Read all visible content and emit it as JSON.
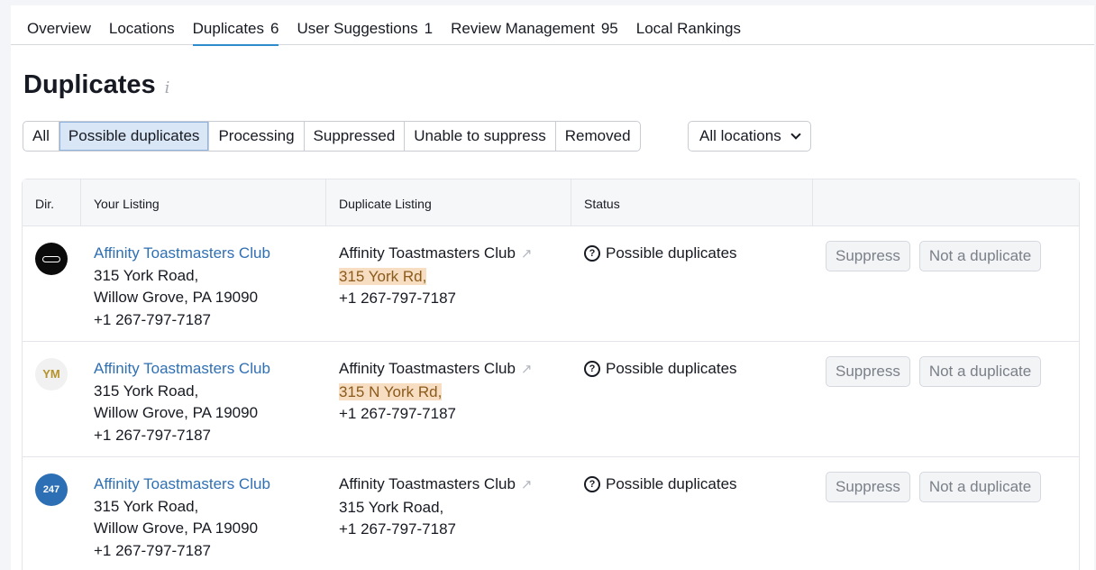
{
  "tabs": [
    {
      "label": "Overview",
      "count": ""
    },
    {
      "label": "Locations",
      "count": ""
    },
    {
      "label": "Duplicates",
      "count": "6"
    },
    {
      "label": "User Suggestions",
      "count": "1"
    },
    {
      "label": "Review Management",
      "count": "95"
    },
    {
      "label": "Local Rankings",
      "count": ""
    }
  ],
  "page": {
    "title": "Duplicates",
    "info_icon": "i"
  },
  "filters": {
    "items": [
      "All",
      "Possible duplicates",
      "Processing",
      "Suppressed",
      "Unable to suppress",
      "Removed"
    ],
    "active": "Possible duplicates",
    "location_select": "All locations"
  },
  "table": {
    "headers": {
      "dir": "Dir.",
      "your_listing": "Your Listing",
      "duplicate_listing": "Duplicate Listing",
      "status": "Status"
    },
    "rows": [
      {
        "dir_icon": "dark-directory-logo",
        "your": {
          "name": "Affinity Toastmasters Club",
          "street": "315 York Road,",
          "city": "Willow Grove, PA 19090",
          "phone": "+1 267-797-7187"
        },
        "dup": {
          "name": "Affinity Toastmasters Club",
          "street": "315 York Rd,",
          "street_highlighted": true,
          "phone": "+1 267-797-7187"
        },
        "status": "Possible duplicates",
        "suppress": "Suppress",
        "not_dup": "Not a duplicate"
      },
      {
        "dir_icon": "ym-directory-logo",
        "dir_text": "YM",
        "your": {
          "name": "Affinity Toastmasters Club",
          "street": "315 York Road,",
          "city": "Willow Grove, PA 19090",
          "phone": "+1 267-797-7187"
        },
        "dup": {
          "name": "Affinity Toastmasters Club",
          "street": "315 N York Rd,",
          "street_highlighted": true,
          "phone": "+1 267-797-7187"
        },
        "status": "Possible duplicates",
        "suppress": "Suppress",
        "not_dup": "Not a duplicate"
      },
      {
        "dir_icon": "247-directory-logo",
        "dir_text": "247",
        "your": {
          "name": "Affinity Toastmasters Club",
          "street": "315 York Road,",
          "city": "Willow Grove, PA 19090",
          "phone": "+1 267-797-7187"
        },
        "dup": {
          "name": "Affinity Toastmasters Club",
          "street": "315 York Road,",
          "street_highlighted": false,
          "phone": "+1 267-797-7187"
        },
        "status": "Possible duplicates",
        "suppress": "Suppress",
        "not_dup": "Not a duplicate"
      }
    ]
  }
}
